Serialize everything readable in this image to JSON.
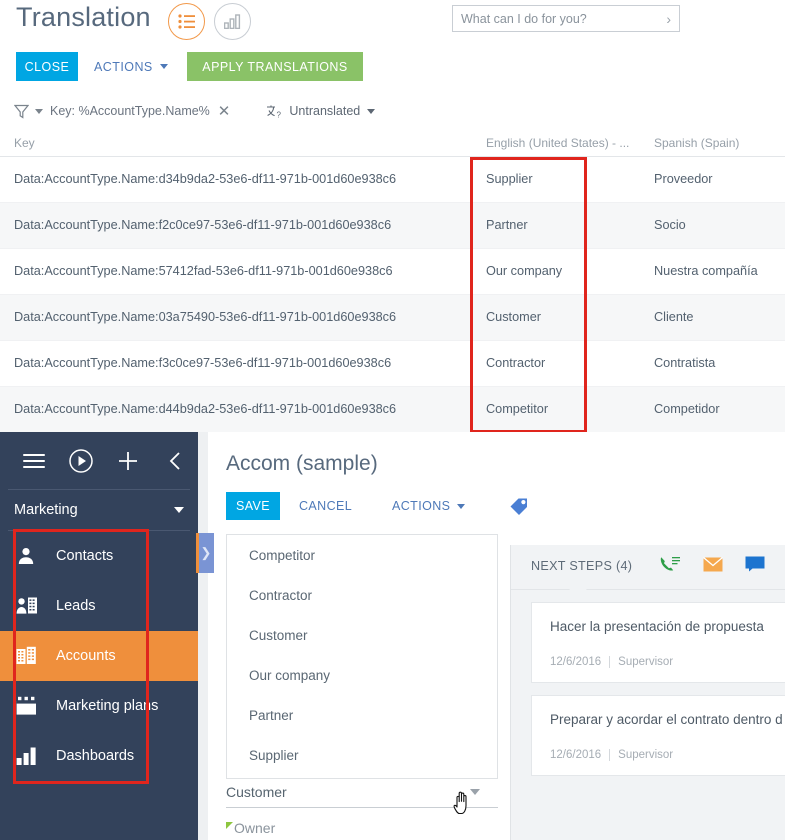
{
  "translation": {
    "title": "Translation",
    "view_toggles": [
      {
        "name": "list-view",
        "icon": "list-icon",
        "active": true
      },
      {
        "name": "chart-view",
        "icon": "bar-chart-icon",
        "active": false
      }
    ],
    "search": {
      "placeholder": "What can I do for you?",
      "value": ""
    },
    "toolbar": {
      "close_label": "CLOSE",
      "actions_label": "ACTIONS",
      "apply_label": "APPLY TRANSLATIONS"
    },
    "filter": {
      "funnel_icon": "filter-funnel-icon",
      "chip_text": "Key: %AccountType.Name%",
      "remove_icon": "close-x-icon",
      "translate_icon": "translate-icon",
      "untranslated_label": "Untranslated"
    },
    "table": {
      "columns": [
        "Key",
        "English (United States) - ...",
        "Spanish (Spain)"
      ],
      "rows": [
        {
          "key": "Data:AccountType.Name:d34b9da2-53e6-df11-971b-001d60e938c6",
          "en": "Supplier",
          "es": "Proveedor"
        },
        {
          "key": "Data:AccountType.Name:f2c0ce97-53e6-df11-971b-001d60e938c6",
          "en": "Partner",
          "es": "Socio"
        },
        {
          "key": "Data:AccountType.Name:57412fad-53e6-df11-971b-001d60e938c6",
          "en": "Our company",
          "es": "Nuestra compañía"
        },
        {
          "key": "Data:AccountType.Name:03a75490-53e6-df11-971b-001d60e938c6",
          "en": "Customer",
          "es": "Cliente"
        },
        {
          "key": "Data:AccountType.Name:f3c0ce97-53e6-df11-971b-001d60e938c6",
          "en": "Contractor",
          "es": "Contratista"
        },
        {
          "key": "Data:AccountType.Name:d44b9da2-53e6-df11-971b-001d60e938c6",
          "en": "Competitor",
          "es": "Competidor"
        }
      ]
    }
  },
  "crm": {
    "sidebar": {
      "top_icons": [
        "menu-icon",
        "run-process-icon",
        "add-icon",
        "collapse-icon"
      ],
      "workplace": "Marketing",
      "items": [
        {
          "label": "Contacts",
          "icon": "contact-icon",
          "active": false
        },
        {
          "label": "Leads",
          "icon": "leads-icon",
          "active": false
        },
        {
          "label": "Accounts",
          "icon": "accounts-icon",
          "active": true
        },
        {
          "label": "Marketing plans",
          "icon": "calendar-icon",
          "active": false
        },
        {
          "label": "Dashboards",
          "icon": "bar-chart-icon",
          "active": false
        }
      ]
    },
    "record": {
      "title": "Accom (sample)",
      "toolbar": {
        "save_label": "SAVE",
        "cancel_label": "CANCEL",
        "actions_label": "ACTIONS",
        "tag_icon": "tag-icon"
      },
      "dropdown": {
        "options": [
          "Competitor",
          "Contractor",
          "Customer",
          "Our company",
          "Partner",
          "Supplier"
        ]
      },
      "fields": [
        {
          "label": "Customer",
          "type": "select"
        },
        {
          "label": "Owner",
          "type": "lookup",
          "required": true
        }
      ]
    },
    "right_panel": {
      "tab_label": "NEXT STEPS (4)",
      "icons": [
        "call-icon",
        "email-icon",
        "chat-icon",
        "flag-icon"
      ],
      "cards": [
        {
          "title": "Hacer la presentación de propuesta",
          "date": "12/6/2016",
          "owner": "Supervisor"
        },
        {
          "title": "Preparar y acordar el contrato dentro d",
          "date": "12/6/2016",
          "owner": "Supervisor"
        }
      ]
    }
  },
  "colors": {
    "primary_blue": "#00a6e3",
    "green": "#8ac267",
    "sidebar": "#33425b",
    "accent_orange": "#ef8f3c",
    "annotation_red": "#e0251d",
    "link_blue": "#4e79b8"
  }
}
